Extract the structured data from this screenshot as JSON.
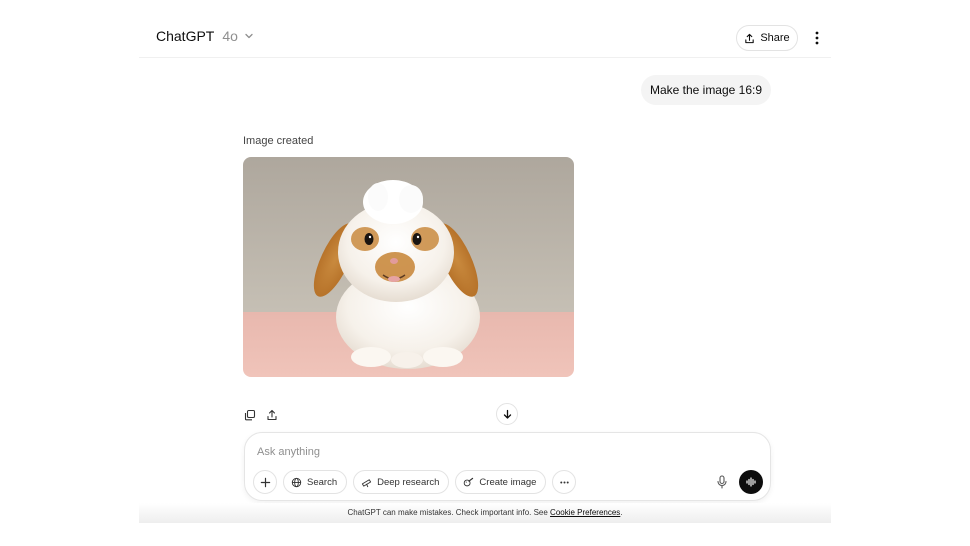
{
  "header": {
    "model_name": "ChatGPT",
    "model_version": "4o",
    "share_label": "Share"
  },
  "conversation": {
    "user_message": "Make the image 16:9",
    "image_status": "Image created",
    "image_subject": "bunny-photo"
  },
  "composer": {
    "placeholder": "Ask anything",
    "value": "",
    "tools": {
      "search_label": "Search",
      "deep_research_label": "Deep research",
      "create_image_label": "Create image"
    }
  },
  "footer": {
    "disclaimer_text": "ChatGPT can make mistakes. Check important info. See ",
    "cookie_link": "Cookie Preferences",
    "disclaimer_end": "."
  },
  "colors": {
    "accent_dark": "#0d0d0d",
    "user_bubble": "#f4f4f4",
    "muted_text": "#8f8f8f"
  },
  "icons": [
    "chevron-down-icon",
    "share-icon",
    "more-vertical-icon",
    "copy-icon",
    "upload-icon",
    "arrow-down-icon",
    "plus-icon",
    "globe-icon",
    "telescope-icon",
    "image-brush-icon",
    "more-horizontal-icon",
    "mic-icon",
    "voice-waveform-icon"
  ]
}
